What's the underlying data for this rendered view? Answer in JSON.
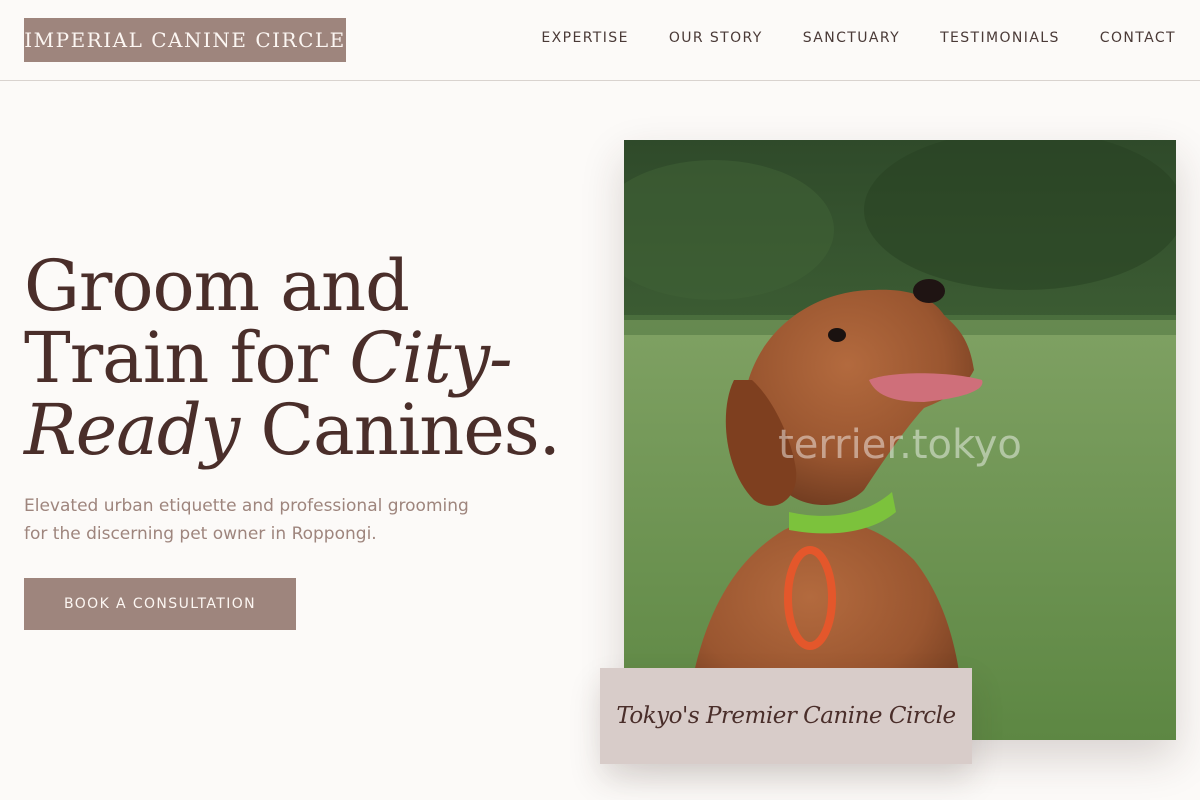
{
  "header": {
    "logo": "IMPERIAL CANINE CIRCLE",
    "nav": [
      "EXPERTISE",
      "OUR STORY",
      "SANCTUARY",
      "TESTIMONIALS",
      "CONTACT"
    ]
  },
  "hero": {
    "headline_part1": "Groom and",
    "headline_part2": "Train for ",
    "headline_italic1": "City-",
    "headline_italic2": "Ready",
    "headline_part3": " Canines.",
    "subtext": "Elevated urban etiquette and professional grooming for the discerning pet owner in Roppongi.",
    "cta_label": "BOOK A CONSULTATION",
    "image_watermark": "terrier.tokyo",
    "image_subject": "dog-photo",
    "caption": "Tokyo's Premier Canine Circle"
  },
  "colors": {
    "background": "#fcfaf8",
    "brand": "#9e857d",
    "text_dark": "#4a2e2a",
    "caption_bg": "#d8ccc9"
  }
}
